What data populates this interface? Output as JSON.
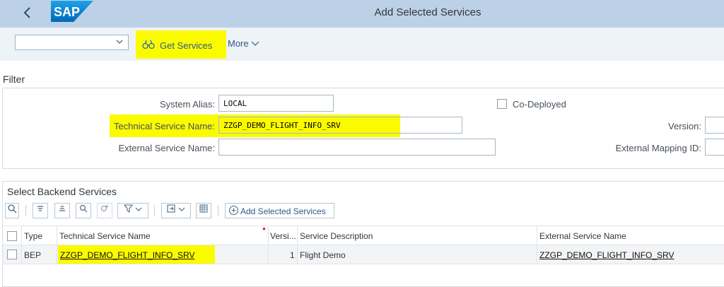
{
  "header": {
    "title": "Add Selected Services",
    "logo_text": "SAP",
    "back_icon": "chevron-left-icon"
  },
  "toolbar": {
    "dropdown_value": "",
    "get_services_label": "Get Services",
    "get_services_icon": "binoculars-icon",
    "more_label": "More"
  },
  "filter": {
    "section_label": "Filter",
    "system_alias_label": "System Alias:",
    "system_alias_value": "LOCAL",
    "tech_service_label": "Technical Service Name:",
    "tech_service_value": "ZZGP_DEMO_FLIGHT_INFO_SRV",
    "external_service_label": "External Service Name:",
    "external_service_value": "",
    "co_deployed_label": "Co-Deployed",
    "version_label": "Version:",
    "external_mapping_label": "External Mapping ID:"
  },
  "services": {
    "title": "Select Backend Services",
    "add_selected_label": "Add Selected Services",
    "columns": [
      "Type",
      "Technical Service Name",
      "Versi...",
      "Service Description",
      "External Service Name"
    ],
    "rows": [
      {
        "type": "BEP",
        "tech_name": "ZZGP_DEMO_FLIGHT_INFO_SRV",
        "version": "1",
        "description": "Flight Demo",
        "external_name": "ZZGP_DEMO_FLIGHT_INFO_SRV"
      }
    ]
  },
  "colors": {
    "header_bg": "#bdd1e6",
    "highlight": "#fbfb00",
    "toolbar_bg": "#eef3f8"
  }
}
